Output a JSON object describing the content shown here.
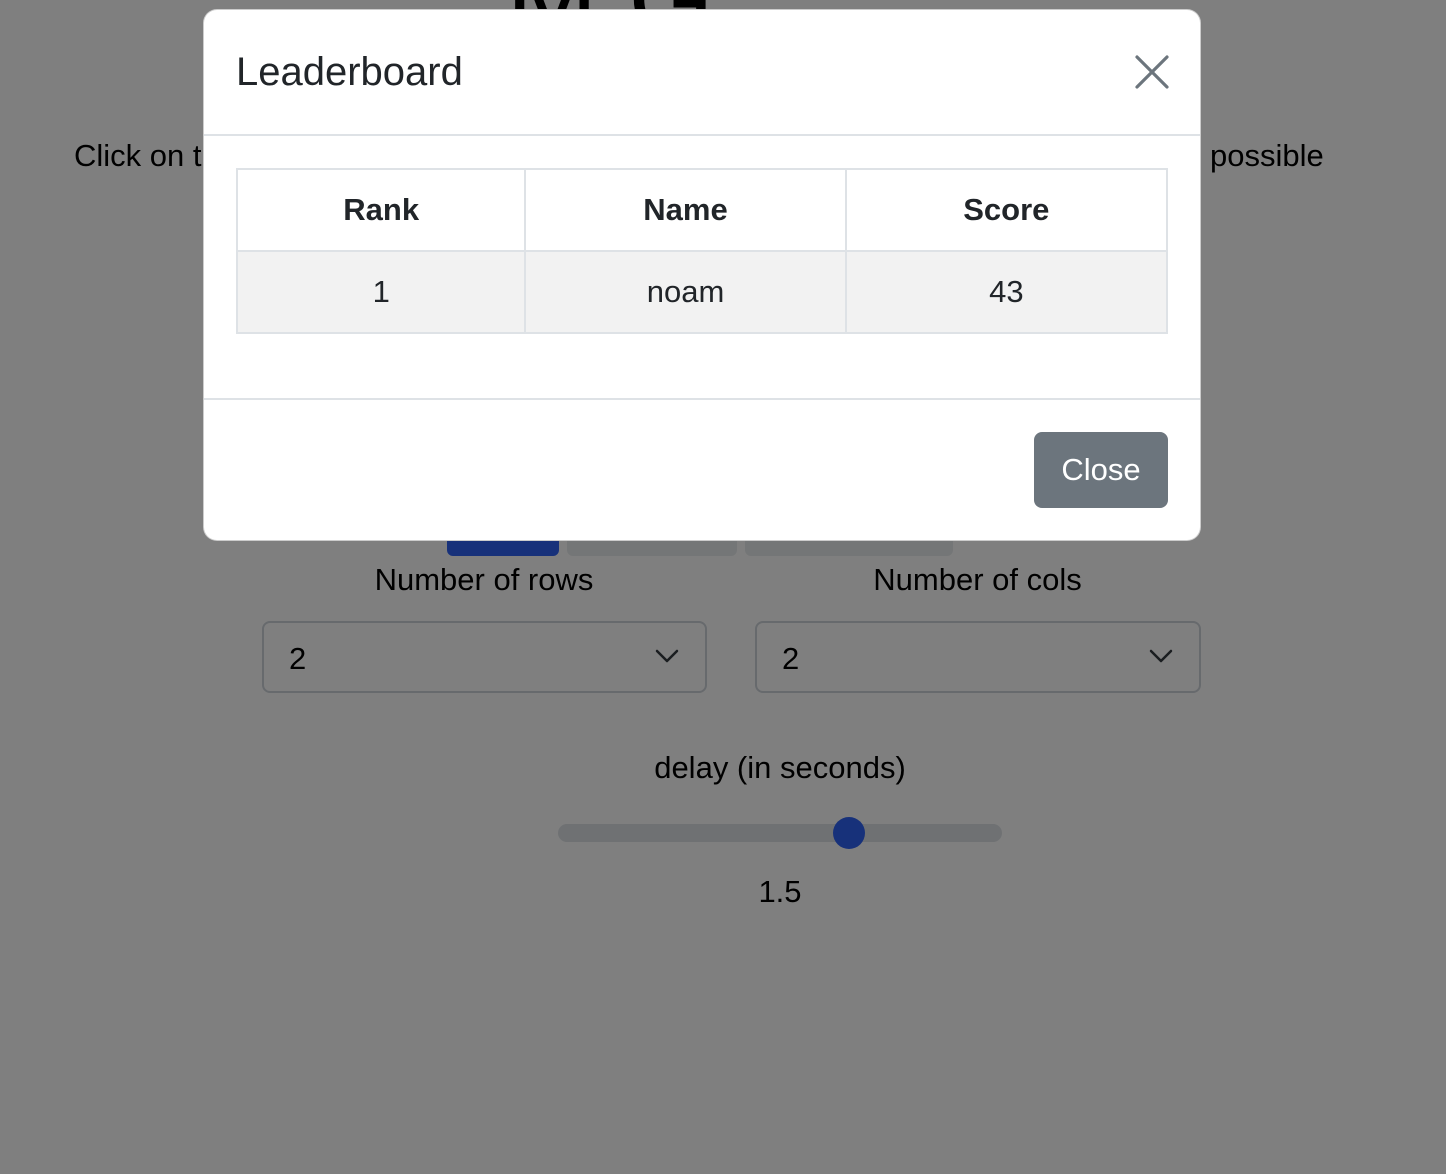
{
  "page": {
    "title": "M   G",
    "instructions_start": "Click on t",
    "instructions_end": "possible",
    "rows": {
      "label": "Number of rows",
      "value": "2"
    },
    "cols": {
      "label": "Number of cols",
      "value": "2"
    },
    "delay": {
      "label": "delay (in seconds)",
      "value": "1.5",
      "slider_fraction": 0.655
    },
    "colors": {
      "accent": "#2f62f5",
      "secondary": "#6c757d",
      "backdrop": "rgba(0,0,0,0.5)"
    }
  },
  "modal": {
    "title": "Leaderboard",
    "close_icon": "close-icon",
    "table": {
      "headers": [
        "Rank",
        "Name",
        "Score"
      ],
      "rows": [
        [
          "1",
          "noam",
          "43"
        ]
      ]
    },
    "close_label": "Close"
  }
}
